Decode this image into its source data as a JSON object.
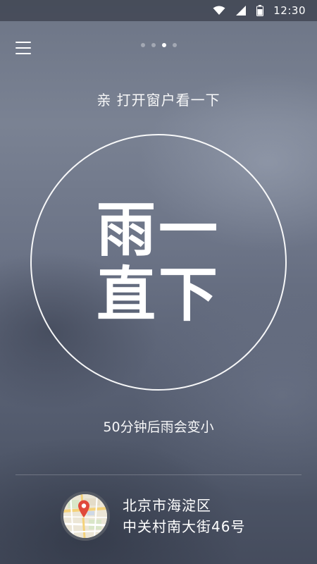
{
  "status_bar": {
    "time": "12:30",
    "icons": [
      "wifi-icon",
      "signal-icon",
      "battery-icon"
    ]
  },
  "header": {
    "menu_icon": "menu-icon",
    "page_count": 4,
    "active_page": 3
  },
  "weather": {
    "tip": "亲 打开窗户看一下",
    "headline_line1": "雨一",
    "headline_line2": "直下",
    "forecast": "50分钟后雨会变小"
  },
  "location": {
    "map_icon": "map-pin-icon",
    "district": "北京市海淀区",
    "street": "中关村南大街46号"
  }
}
